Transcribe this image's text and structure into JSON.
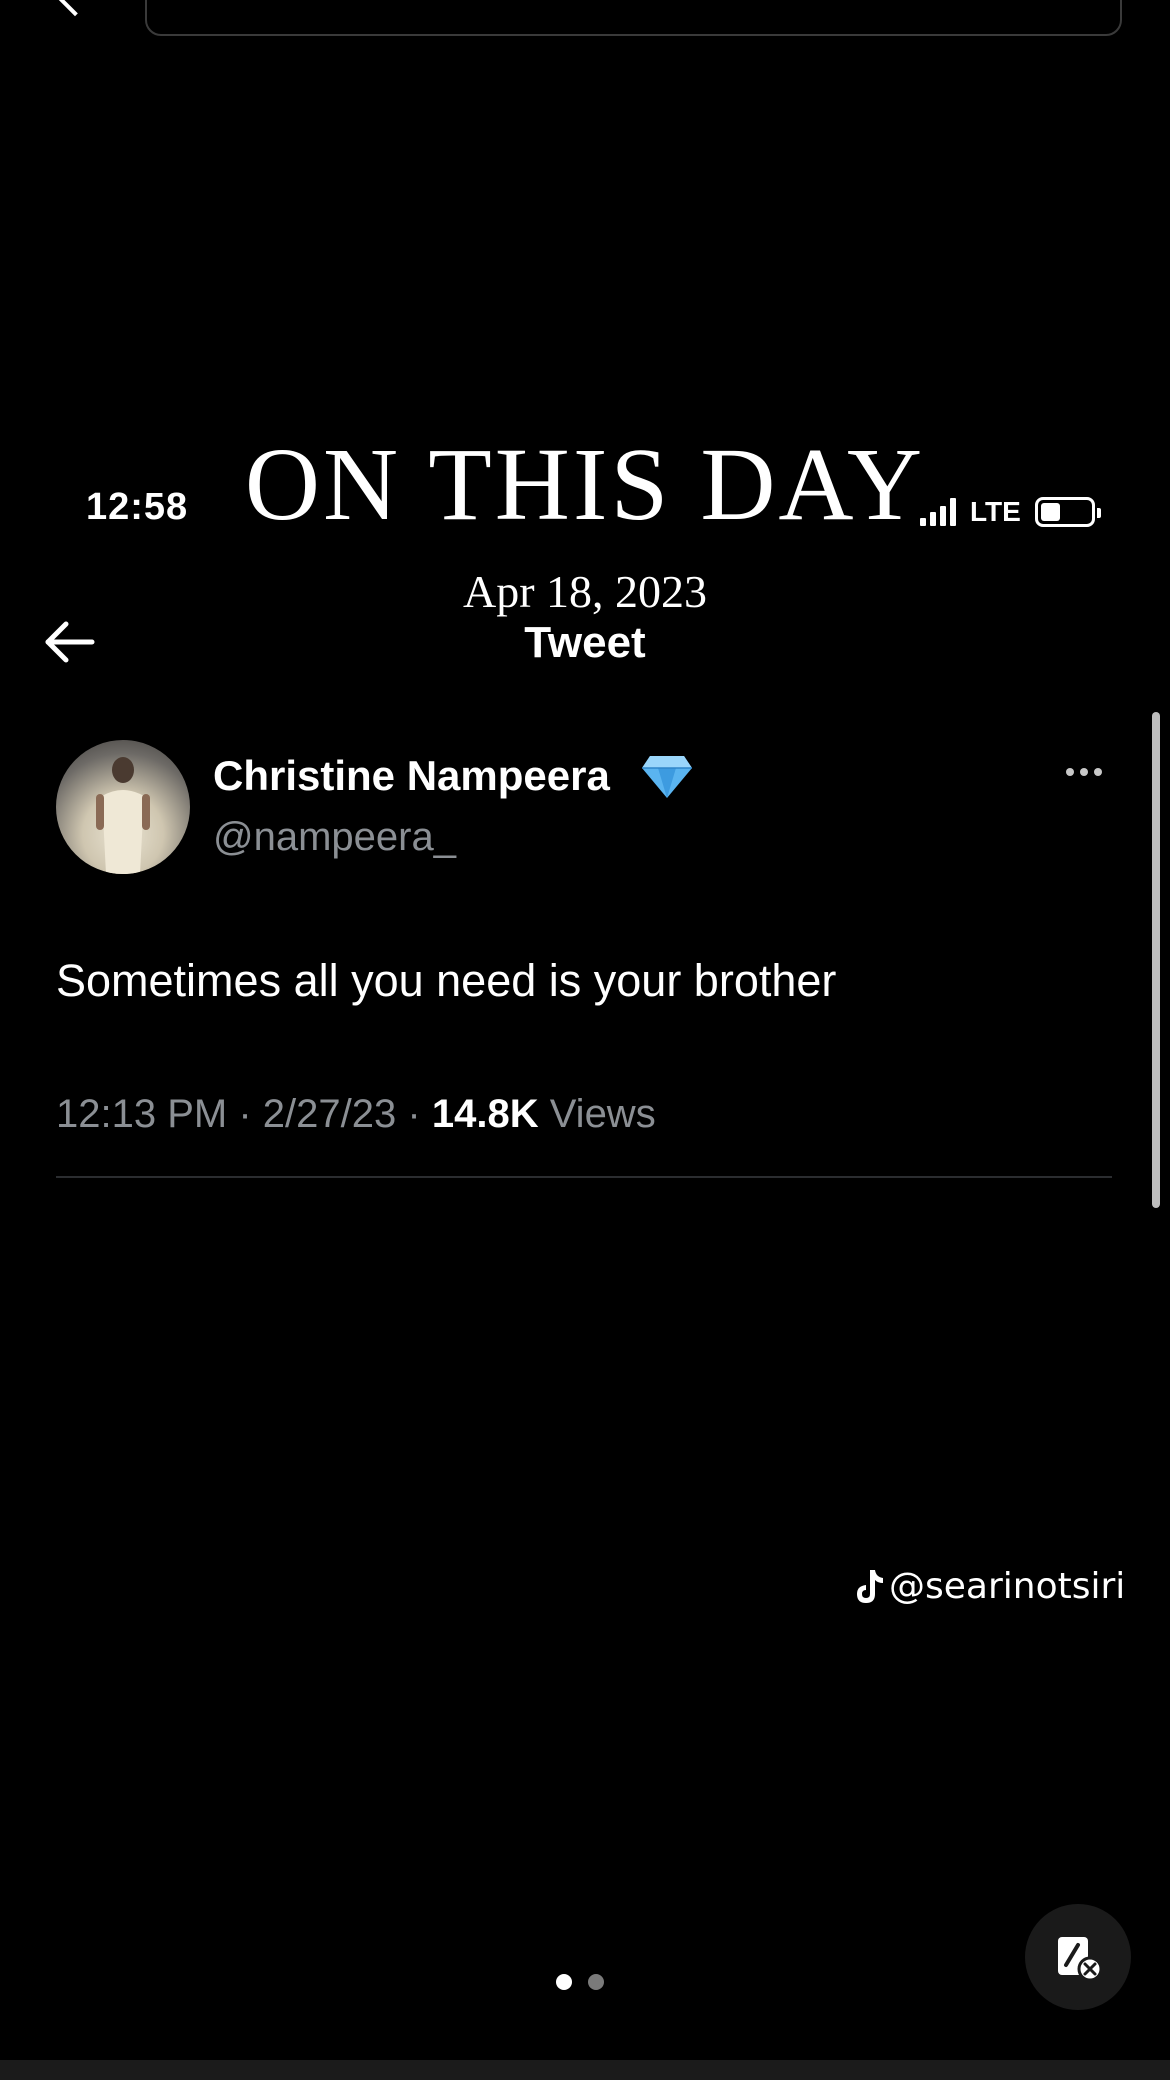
{
  "overlay": {
    "title": "ON THIS DAY",
    "date": "Apr 18, 2023"
  },
  "status_bar": {
    "time": "12:58",
    "network": "LTE",
    "battery_level": 0.4
  },
  "header": {
    "title": "Tweet"
  },
  "tweet": {
    "author_name": "Christine Nampeera",
    "author_handle": "@nampeera_",
    "text": "Sometimes all you need is your brother",
    "time": "12:13 PM",
    "date": "2/27/23",
    "views_count": "14.8K",
    "views_label": "Views",
    "separator": "·"
  },
  "watermark": {
    "handle": "@searinotsiri"
  },
  "pager": {
    "pages": 2,
    "current": 1
  },
  "colors": {
    "background": "#000000",
    "text_primary": "#ffffff",
    "text_secondary": "#8b8f94",
    "diamond": "#5ab4f0"
  },
  "icons": {
    "back": "arrow-left-icon",
    "more": "more-horizontal-icon",
    "verified": "diamond-icon",
    "watermark": "tiktok-icon",
    "floating": "edit-off-icon"
  }
}
